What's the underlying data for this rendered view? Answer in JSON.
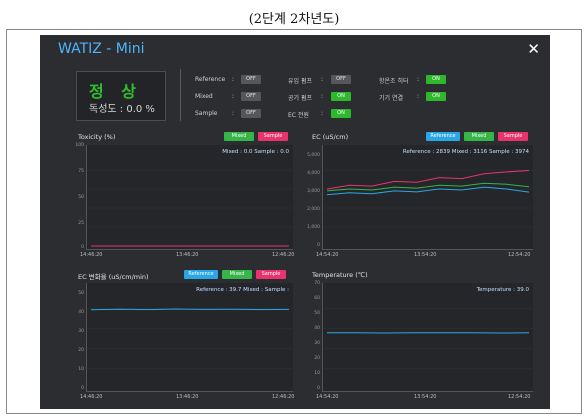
{
  "caption": "(2단계 2차년도)",
  "window": {
    "title": "WATIZ - Mini",
    "close_glyph": "✕"
  },
  "status": {
    "state": "정 상",
    "toxicity_label": "독성도 : 0.0 %"
  },
  "controls": [
    {
      "label": "Reference",
      "value": "OFF",
      "on": false
    },
    {
      "label": "Mixed",
      "value": "OFF",
      "on": false
    },
    {
      "label": "Sample",
      "value": "OFF",
      "on": false
    },
    {
      "label": "유입 펌프",
      "value": "OFF",
      "on": false
    },
    {
      "label": "공기 펌프",
      "value": "ON",
      "on": true
    },
    {
      "label": "EC 전원",
      "value": "ON",
      "on": true
    },
    {
      "label": "항온조 히터",
      "value": "ON",
      "on": true
    },
    {
      "label": "기기 연결",
      "value": "ON",
      "on": true
    }
  ],
  "colors": {
    "reference": "#2aa6e8",
    "mixed": "#35b54a",
    "sample": "#e8336d",
    "accent": "#4fb3ff",
    "ok": "#2ec02e"
  },
  "panels": {
    "toxicity": {
      "title": "Toxicity (%)",
      "legend": [
        "Mixed",
        "Sample"
      ],
      "readout": "Mixed : 0.0   Sample : 0.0",
      "yticks": [
        "100",
        "75",
        "50",
        "25",
        "0"
      ],
      "xticks": [
        "14:46:20",
        "13:46:20",
        "12:46:20"
      ]
    },
    "ec": {
      "title": "EC (uS/cm)",
      "legend": [
        "Reference",
        "Mixed",
        "Sample"
      ],
      "readout": "Reference : 2839   Mixed : 3116   Sample : 3974",
      "yticks": [
        "5,000",
        "4,000",
        "3,000",
        "2,000",
        "1,000",
        "0"
      ],
      "xticks": [
        "14:54:20",
        "13:54:20",
        "12:54:20"
      ]
    },
    "ecrate": {
      "title": "EC 변화율 (uS/cm/min)",
      "legend": [
        "Reference",
        "Mixed",
        "Sample"
      ],
      "readout": "Reference : 39.7   Mixed :    Sample :",
      "yticks": [
        "50",
        "40",
        "30",
        "20",
        "10",
        "0"
      ],
      "xticks": [
        "14:46:20",
        "13:46:20",
        "12:46:20"
      ]
    },
    "temperature": {
      "title": "Temperature (℃)",
      "legend": [],
      "readout": "Temperature : 39.0",
      "yticks": [
        "70",
        "60",
        "50",
        "40",
        "30",
        "20",
        "10",
        "0"
      ],
      "xticks": [
        "14:54:20",
        "13:54:20",
        "12:54:20"
      ]
    }
  },
  "chart_data": [
    {
      "type": "line",
      "title": "Toxicity (%)",
      "ylim": [
        0,
        100
      ],
      "series": [
        {
          "name": "Mixed",
          "values": [
            0,
            0,
            0,
            0,
            0
          ]
        },
        {
          "name": "Sample",
          "values": [
            0,
            0,
            0,
            0,
            0
          ]
        }
      ]
    },
    {
      "type": "line",
      "title": "EC (uS/cm)",
      "ylim": [
        0,
        5000
      ],
      "series": [
        {
          "name": "Reference",
          "values": [
            2700,
            2800,
            2750,
            2900,
            2850,
            3000,
            2950,
            3100,
            3000,
            2839
          ]
        },
        {
          "name": "Mixed",
          "values": [
            2900,
            3000,
            2950,
            3100,
            3050,
            3200,
            3150,
            3300,
            3250,
            3116
          ]
        },
        {
          "name": "Sample",
          "values": [
            3000,
            3200,
            3150,
            3400,
            3350,
            3600,
            3550,
            3800,
            3900,
            3974
          ]
        }
      ]
    },
    {
      "type": "line",
      "title": "EC 변화율 (uS/cm/min)",
      "ylim": [
        0,
        50
      ],
      "series": [
        {
          "name": "Reference",
          "values": [
            39.5,
            39.8,
            39.6,
            39.9,
            39.7,
            39.8,
            39.6,
            39.7
          ]
        }
      ]
    },
    {
      "type": "line",
      "title": "Temperature (℃)",
      "ylim": [
        0,
        70
      ],
      "series": [
        {
          "name": "Temperature",
          "values": [
            39.0,
            39.1,
            38.9,
            39.0,
            39.1,
            39.0,
            38.9,
            39.0
          ]
        }
      ]
    }
  ]
}
